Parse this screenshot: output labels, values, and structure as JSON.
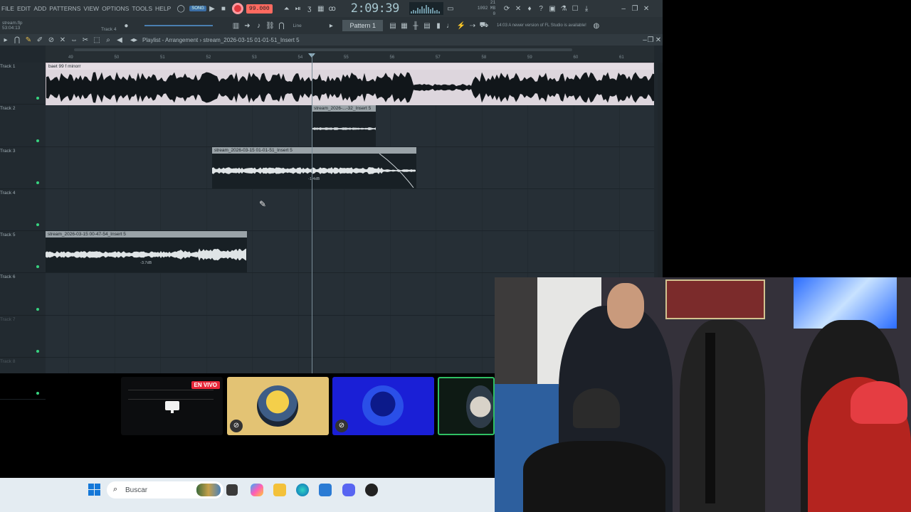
{
  "app": {
    "menu": [
      "FILE",
      "EDIT",
      "ADD",
      "PATTERNS",
      "VIEW",
      "OPTIONS",
      "TOOLS",
      "HELP"
    ],
    "song_mode": "SONG",
    "tempo": "99.000",
    "clock": "2:09:39",
    "cpu_readout": [
      "21",
      "1092 MB",
      "0"
    ],
    "project_file": "stream.flp",
    "project_time": "53:04:13",
    "hint_track": "Track 4",
    "snap_label": "Line",
    "pattern": "Pattern 1",
    "update_notice": "A newer version of FL Studio is available!",
    "update_prefix": "14:03",
    "breadcrumb": "Playlist - Arrangement",
    "breadcrumb_clip": "stream_2026-03-15 01-01-51_Insert 5",
    "icons": {
      "record": "record-icon",
      "play": "play-icon",
      "stop": "stop-icon",
      "metronome": "metronome-icon",
      "mixer": "mixer-icon",
      "piano-roll": "piano-roll-icon",
      "browser": "browser-icon",
      "plugin": "plugin-icon"
    }
  },
  "ruler_ticks": [
    "49",
    "50",
    "51",
    "52",
    "53",
    "54",
    "55",
    "56",
    "57",
    "58",
    "59",
    "60",
    "61"
  ],
  "tracks": [
    "Track 1",
    "Track 2",
    "Track 3",
    "Track 4",
    "Track 5",
    "Track 6",
    "Track 7",
    "Track 8"
  ],
  "clips": {
    "c1": {
      "name": "baet 99 f minorr"
    },
    "c2": {
      "name": "stream_2026-...-32_Insert 5"
    },
    "c3": {
      "name": "stream_2026-03-15 01-01-51_Insert 5",
      "volume": "-1.4dB"
    },
    "c4": {
      "name": "stream_2026-03-15 00-47-54_Insert 5",
      "volume": "-3.7dB"
    }
  },
  "stream": {
    "live_badge": "EN VIVO"
  },
  "taskbar": {
    "search_placeholder": "Buscar"
  },
  "colors": {
    "accent": "#3b6ea5",
    "live": "#e8283a",
    "record": "#e0383e"
  }
}
